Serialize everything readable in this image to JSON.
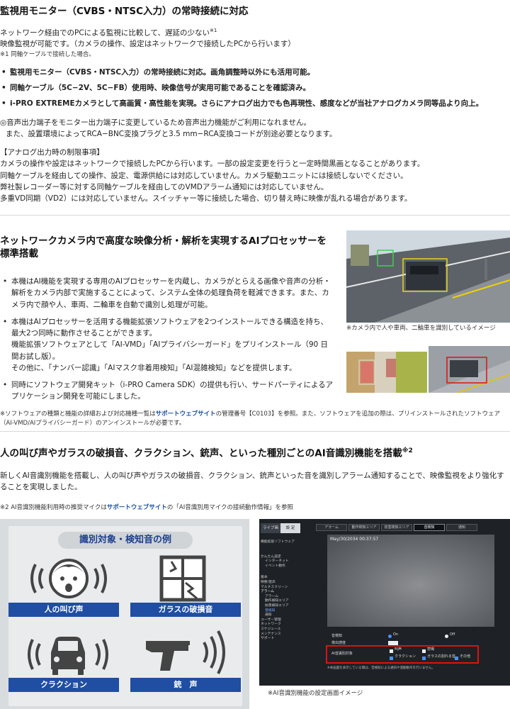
{
  "s1": {
    "title": "監視用モニター（CVBS・NTSC入力）の常時接続に対応",
    "intro_a": "ネットワーク経由でのPCによる監視に比較して、遅延の少ない",
    "intro_sup": "※1",
    "intro_b": "映像監視が可能です。（カメラの操作、設定はネットワークで接続したPCから行います）",
    "note1": "※1 同軸ケーブルで接続した場合。",
    "bullets": [
      "監視用モニター（CVBS・NTSC入力）の常時接続に対応。画角調整時以外にも活用可能。",
      "同軸ケーブル（5C−2V、5C−FB）使用時、映像信号が実用可能であることを確認済み。",
      "i-PRO EXTREMEカメラとして高画質・高性能を実現。さらにアナログ出力でも色再現性、感度などが当社アナログカメラ同等品より向上。"
    ],
    "audio_note_1": "◎音声出力端子をモニター出力端子に変更しているため音声出力機能がご利用になれません。",
    "audio_note_2": "また、設置環境によってRCA−BNC変換プラグと3.5 mm−RCA変換コードが別途必要となります。",
    "limit_title": "【アナログ出力時の制限事項】",
    "limits": [
      "カメラの操作や設定はネットワークで接続したPCから行います。一部の設定変更を行うと一定時間黒画となることがあります。",
      "同軸ケーブルを経由しての操作、設定、電源供給には対応していません。カメラ駆動ユニットには接続しないでください。",
      "弊社製レコーダー等に対する同軸ケーブルを経由してのVMDアラーム通知には対応していません。",
      "多重VD同期（VD2）には対応していません。スイッチャー等に接続した場合、切り替え時に映像が乱れる場合があります。"
    ]
  },
  "s2": {
    "title": "ネットワークカメラ内で高度な映像分析・解析を実現するAIプロセッサーを標準搭載",
    "bullets": [
      "本機はAI機能を実現する専用のAIプロセッサーを内蔵し、カメラがとらえる画像や音声の分析・解析をカメラ内部で実施することによって、システム全体の処理負荷を軽減できます。また、カメラ内で顔や人、車両、二輪車を自動で識別し処理が可能。",
      "本機はAIプロセッサーを活用する機能拡張ソフトウェアを2つインストールできる構造を持ち、最大2つ同時に動作させることができます。",
      "同時にソフトウェア開発キット（i-PRO Camera SDK）の提供も行い、サードパーティによるアプリケーション開発を可能にしました。"
    ],
    "sub_1": "機能拡張ソフトウェアとして「AI-VMD」「AIプライバシーガード」をプリインストール（90 日間お試し版）。",
    "sub_2": "その他に、「ナンバー認識」「AIマスク非着用検知」「AI混雑検知」などを提供します。",
    "caption": "※カメラ内で人や車両、二輪車を識別しているイメージ",
    "note_a": "※ソフトウェアの種類と機能の詳細および対応機種一覧は",
    "note_link": "サポートウェブサイト",
    "note_b": "の管理番号【C0103】を参照。また、ソフトウェアを追加の際は、プリインストールされたソフトウェア（AI-VMD/AIプライバシーガード）のアンインストールが必要です。"
  },
  "s3": {
    "title": "人の叫び声やガラスの破損音、クラクション、銃声、といった種別ごとのAI音識別機能を搭載",
    "title_sup": "※2",
    "body": "新しくAI音識別機能を搭載し、人の叫び声やガラスの破損音、クラクション、銃声といった音を識別しアラーム通知することで、映像監視をより強化することを実現しました。",
    "note_a": "※2 AI音識別機能利用時の推奨マイクは",
    "note_link": "サポートウェブサイト",
    "note_b": "の「AI音識別用マイクの接続動作情報」を参照",
    "panel_title": "識別対象・検知音の例",
    "labels": [
      "人の叫び声",
      "ガラスの破損音",
      "クラクション",
      "銃　声"
    ],
    "ui_caption": "※AI音識別機能の設定画面イメージ"
  },
  "ui": {
    "tabs": [
      "ライブ画",
      "設 定"
    ],
    "top_tabs": [
      "アラーム",
      "動作検知エリア",
      "妨害検知エリア",
      "音検知",
      "通知"
    ],
    "timestamp": "May/30/2034 00:37:57",
    "menu": [
      "機能拡張ソフトウェア",
      "かんたん設定",
      "インターネット",
      "イベント動作",
      "基本",
      "映像/音声",
      "マルチスクリーン",
      "アラーム",
      "アラーム",
      "動作検知エリア",
      "妨害検知エリア",
      "音検知",
      "通知",
      "ユーザー管理",
      "ネットワーク",
      "スケジュール",
      "メンテナンス",
      "サポート"
    ],
    "rows": [
      "音検知",
      "検出感度",
      "AI音識別対象"
    ],
    "on": "On",
    "off": "Off",
    "opts": [
      "叫声",
      "悲鳴",
      "クラクション",
      "ガラスの割れる音",
      "その他"
    ],
    "footnote": "※本画面を表示している間は、音検知による通知や連動動作を行いません。"
  },
  "colors": {
    "accent_blue": "#1f4ea3",
    "link": "#1a4fa8",
    "alert_red": "#e01010"
  }
}
